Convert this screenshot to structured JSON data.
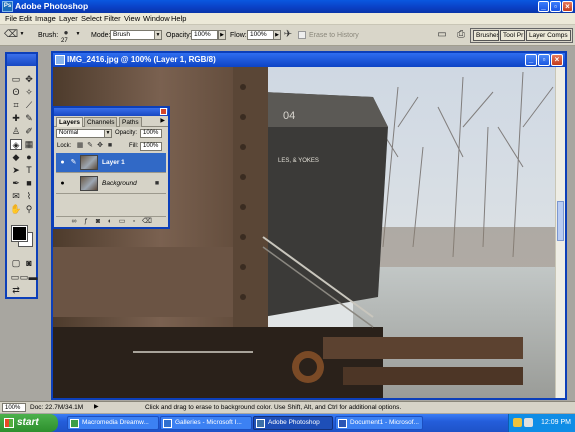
{
  "app": {
    "title": "Adobe Photoshop",
    "icon": "photoshop-icon"
  },
  "menu": [
    "File",
    "Edit",
    "Image",
    "Layer",
    "Select",
    "Filter",
    "View",
    "Window",
    "Help"
  ],
  "options": {
    "brush_label": "Brush:",
    "brush_size": "27",
    "mode_label": "Mode:",
    "mode_value": "Brush",
    "opacity_label": "Opacity:",
    "opacity_value": "100%",
    "flow_label": "Flow:",
    "flow_value": "100%",
    "erase_history": "Erase to History"
  },
  "palette_well": [
    "Brushes",
    "Tool Pr",
    "Layer Comps"
  ],
  "document": {
    "title": "IMG_2416.jpg @ 100% (Layer 1, RGB/8)",
    "car_text": "04",
    "car_stencil": "LES, & YOKES"
  },
  "layers_panel": {
    "tabs": [
      "Layers",
      "Channels",
      "Paths"
    ],
    "blend_mode": "Normal",
    "opacity_label": "Opacity:",
    "opacity_value": "100%",
    "lock_label": "Lock:",
    "fill_label": "Fill:",
    "fill_value": "100%",
    "layers": [
      {
        "name": "Layer 1",
        "selected": true
      },
      {
        "name": "Background",
        "selected": false
      }
    ]
  },
  "status": {
    "zoom": "100%",
    "doc": "Doc: 22.7M/34.1M",
    "hint": "Click and drag to erase to background color. Use Shift, Alt, and Ctrl for additional options."
  },
  "taskbar": {
    "start": "start",
    "buttons": [
      "Macromedia Dreamw...",
      "Galleries - Microsoft I...",
      "Adobe Photoshop",
      "Document1 - Microsof..."
    ],
    "active_index": 2,
    "time": "12:09 PM"
  },
  "colors": {
    "xp_blue": "#0c3fb9",
    "selection": "#3169c6",
    "start_green": "#3c9e3c"
  }
}
